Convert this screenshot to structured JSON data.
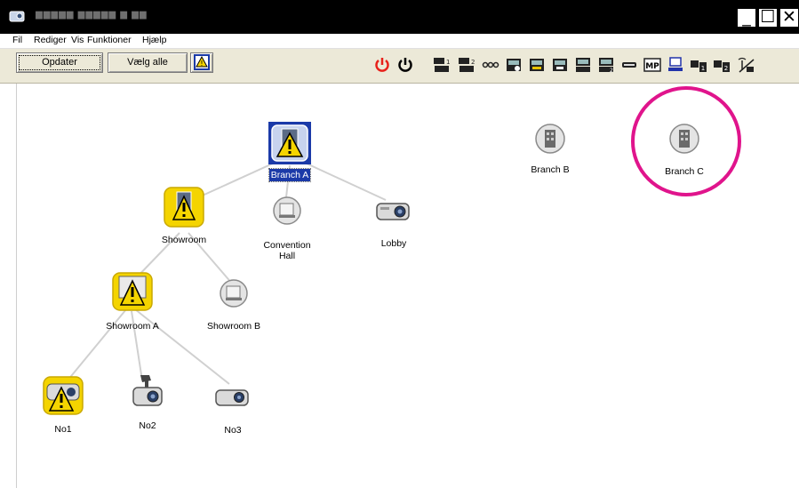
{
  "menu": [
    "Fil",
    "Rediger",
    "Vis",
    "Funktioner",
    "Hjælp"
  ],
  "toolbar": {
    "update_label": "Opdater",
    "select_all_label": "Vælg alle",
    "icons": [
      "warning-filter-icon",
      "power-on-icon",
      "power-off-icon",
      "computer1-icon",
      "computer2-icon",
      "video-icon",
      "s-video-icon",
      "component-icon",
      "hdmi-icon",
      "dvi-icon",
      "easymp-icon",
      "av-mute-icon",
      "mp-icon",
      "network-icon",
      "source1-icon",
      "source2-icon",
      "wireless-icon"
    ]
  },
  "nodes": {
    "branch_a": "Branch A",
    "branch_b": "Branch B",
    "branch_c": "Branch C",
    "showroom": "Showroom",
    "convention_line1": "Convention",
    "convention_line2": "Hall",
    "lobby": "Lobby",
    "showroom_a": "Showroom A",
    "showroom_b": "Showroom B",
    "no1": "No1",
    "no2": "No2",
    "no3": "No3"
  },
  "colors": {
    "warning": "#f4d400",
    "selection": "#1b3aa8",
    "highlight_circle": "#e0148c"
  }
}
